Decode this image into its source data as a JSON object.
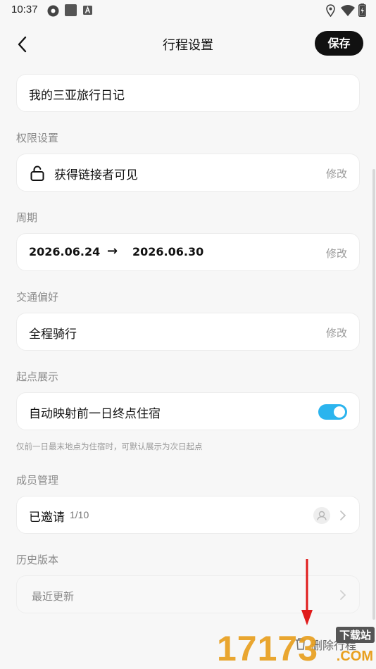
{
  "status_bar": {
    "time": "10:37",
    "icons": [
      "settings-icon",
      "app-square-icon",
      "font-a-icon",
      "location-icon",
      "wifi-icon",
      "battery-icon"
    ]
  },
  "header": {
    "title": "行程设置",
    "save_label": "保存",
    "back_icon": "chevron-left-icon"
  },
  "trip_name": "我的三亚旅行日记",
  "permission": {
    "label": "权限设置",
    "value": "获得链接者可见",
    "edit": "修改",
    "icon": "lock-open-icon"
  },
  "period": {
    "label": "周期",
    "start": "2026.06.24",
    "arrow": "→",
    "end": "2026.06.30",
    "edit": "修改"
  },
  "transport": {
    "label": "交通偏好",
    "value": "全程骑行",
    "edit": "修改"
  },
  "start_point": {
    "label": "起点展示",
    "value": "自动映射前一日终点住宿",
    "toggle_on": true,
    "hint": "仅前一日最末地点为住宿时，可默认展示为次日起点"
  },
  "members": {
    "label": "成员管理",
    "value": "已邀请",
    "count": "1/10"
  },
  "history": {
    "label": "历史版本",
    "value": "最近更新"
  },
  "footer": {
    "delete_label": "删除行程"
  },
  "watermark": {
    "number": "17173",
    "download": "下载站",
    "com": ".COM"
  },
  "colors": {
    "accent": "#2bb4ee",
    "primary": "#111111",
    "muted": "#8a8a8a",
    "background": "#f7f7f7",
    "annotation_arrow": "#e01b1b",
    "watermark": "#e8a020"
  }
}
